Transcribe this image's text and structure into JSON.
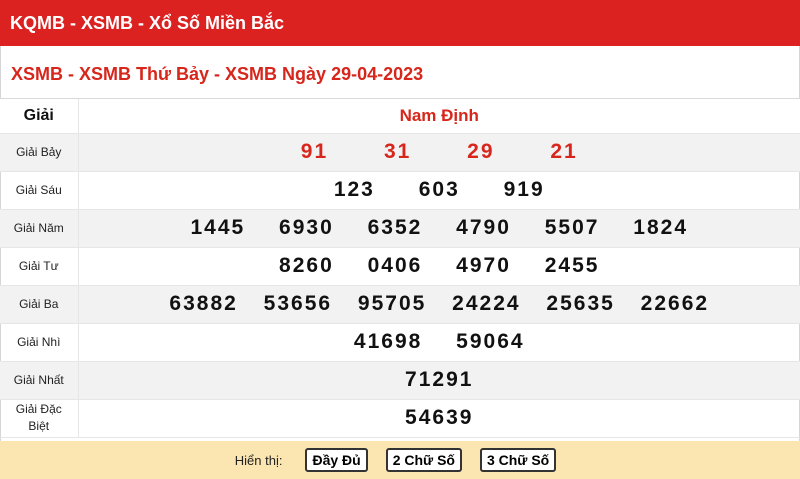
{
  "header": {
    "title": "KQMB - XSMB - Xổ Số Miền Bắc"
  },
  "subtitle": "XSMB - XSMB Thứ Bảy - XSMB Ngày 29-04-2023",
  "table": {
    "col_label": "Giải",
    "province": "Nam Định",
    "rows": [
      {
        "label": "Giải Bảy",
        "numbers": [
          "91",
          "31",
          "29",
          "21"
        ]
      },
      {
        "label": "Giải Sáu",
        "numbers": [
          "123",
          "603",
          "919"
        ]
      },
      {
        "label": "Giải Năm",
        "numbers": [
          "1445",
          "6930",
          "6352",
          "4790",
          "5507",
          "1824"
        ]
      },
      {
        "label": "Giải Tư",
        "numbers": [
          "8260",
          "0406",
          "4970",
          "2455"
        ]
      },
      {
        "label": "Giải Ba",
        "numbers": [
          "63882",
          "53656",
          "95705",
          "24224",
          "25635",
          "22662"
        ]
      },
      {
        "label": "Giải Nhì",
        "numbers": [
          "41698",
          "59064"
        ]
      },
      {
        "label": "Giải Nhất",
        "numbers": [
          "71291"
        ]
      },
      {
        "label": "Giải Đặc Biệt",
        "numbers": [
          "54639"
        ]
      }
    ]
  },
  "footer": {
    "show_label": "Hiển thị:",
    "buttons": [
      "Đầy Đủ",
      "2 Chữ Số",
      "3 Chữ Số"
    ]
  },
  "colors": {
    "brand_red": "#dc2121",
    "number_red": "#d7261b",
    "footer_bg": "#fbe6b2"
  }
}
